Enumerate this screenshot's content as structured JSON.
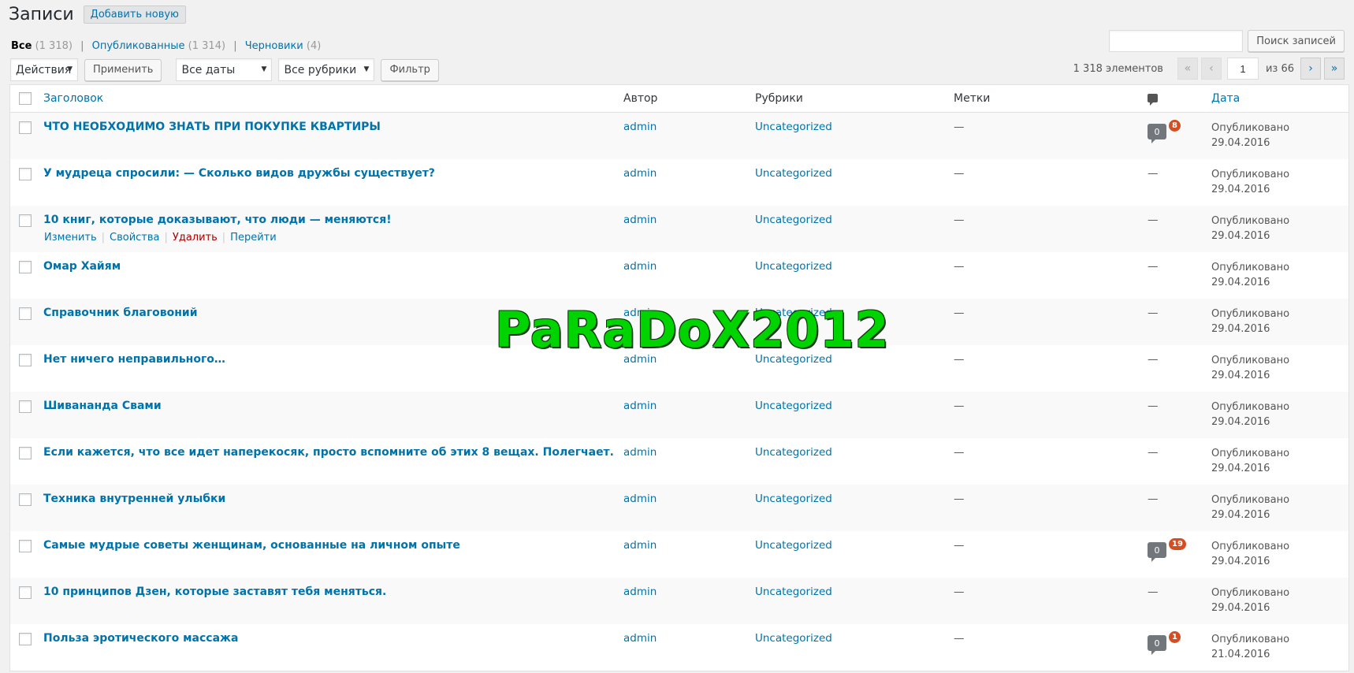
{
  "header": {
    "title": "Записи",
    "add_new": "Добавить новую"
  },
  "filters": {
    "all_label": "Все",
    "all_count": "(1 318)",
    "published_label": "Опубликованные",
    "published_count": "(1 314)",
    "drafts_label": "Черновики",
    "drafts_count": "(4)",
    "sep": "|"
  },
  "search": {
    "button": "Поиск записей",
    "value": ""
  },
  "bulk": {
    "actions": "Действия",
    "apply": "Применить",
    "dates": "Все даты",
    "cats": "Все рубрики",
    "filter": "Фильтр"
  },
  "pagination": {
    "items": "1 318 элементов",
    "first": "«",
    "prev": "‹",
    "current": "1",
    "of": "из 66",
    "next": "›",
    "last": "»"
  },
  "columns": {
    "title": "Заголовок",
    "author": "Автор",
    "categories": "Рубрики",
    "tags": "Метки",
    "date": "Дата"
  },
  "row_actions": {
    "edit": "Изменить",
    "props": "Свойства",
    "delete": "Удалить",
    "view": "Перейти",
    "sep": "|"
  },
  "posts": [
    {
      "title": "ЧТО НЕОБХОДИМО ЗНАТЬ ПРИ ПОКУПКЕ КВАРТИРЫ",
      "author": "admin",
      "category": "Uncategorized",
      "tags": "—",
      "comments": "0",
      "pending": "8",
      "status": "Опубликовано",
      "date": "29.04.2016"
    },
    {
      "title": "У мудреца спросили: — Сколько видов дружбы существует?",
      "author": "admin",
      "category": "Uncategorized",
      "tags": "—",
      "comments": "—",
      "pending": "",
      "status": "Опубликовано",
      "date": "29.04.2016"
    },
    {
      "title": "10 книг, которые доказывают, что люди — меняются!",
      "author": "admin",
      "category": "Uncategorized",
      "tags": "—",
      "comments": "—",
      "pending": "",
      "status": "Опубликовано",
      "date": "29.04.2016"
    },
    {
      "title": "Омар Хайям",
      "author": "admin",
      "category": "Uncategorized",
      "tags": "—",
      "comments": "—",
      "pending": "",
      "status": "Опубликовано",
      "date": "29.04.2016"
    },
    {
      "title": "Справочник благовоний",
      "author": "admin",
      "category": "Uncategorized",
      "tags": "—",
      "comments": "—",
      "pending": "",
      "status": "Опубликовано",
      "date": "29.04.2016"
    },
    {
      "title": "Нет ничего неправильного…",
      "author": "admin",
      "category": "Uncategorized",
      "tags": "—",
      "comments": "—",
      "pending": "",
      "status": "Опубликовано",
      "date": "29.04.2016"
    },
    {
      "title": "Шивананда Свами",
      "author": "admin",
      "category": "Uncategorized",
      "tags": "—",
      "comments": "—",
      "pending": "",
      "status": "Опубликовано",
      "date": "29.04.2016"
    },
    {
      "title": "Если кажется, что все идет наперекосяк, просто вспомните об этих 8 вещах. Полегчает.",
      "author": "admin",
      "category": "Uncategorized",
      "tags": "—",
      "comments": "—",
      "pending": "",
      "status": "Опубликовано",
      "date": "29.04.2016"
    },
    {
      "title": "Техника внутренней улыбки",
      "author": "admin",
      "category": "Uncategorized",
      "tags": "—",
      "comments": "—",
      "pending": "",
      "status": "Опубликовано",
      "date": "29.04.2016"
    },
    {
      "title": "Самые мудрые советы женщинам, основанные на личном опыте",
      "author": "admin",
      "category": "Uncategorized",
      "tags": "—",
      "comments": "0",
      "pending": "19",
      "status": "Опубликовано",
      "date": "29.04.2016"
    },
    {
      "title": "10 принципов Дзен, которые заставят тебя меняться.",
      "author": "admin",
      "category": "Uncategorized",
      "tags": "—",
      "comments": "—",
      "pending": "",
      "status": "Опубликовано",
      "date": "29.04.2016"
    },
    {
      "title": "Польза эротического массажа",
      "author": "admin",
      "category": "Uncategorized",
      "tags": "—",
      "comments": "0",
      "pending": "1",
      "status": "Опубликовано",
      "date": "21.04.2016"
    }
  ],
  "watermark": "PaRaDoX2012"
}
